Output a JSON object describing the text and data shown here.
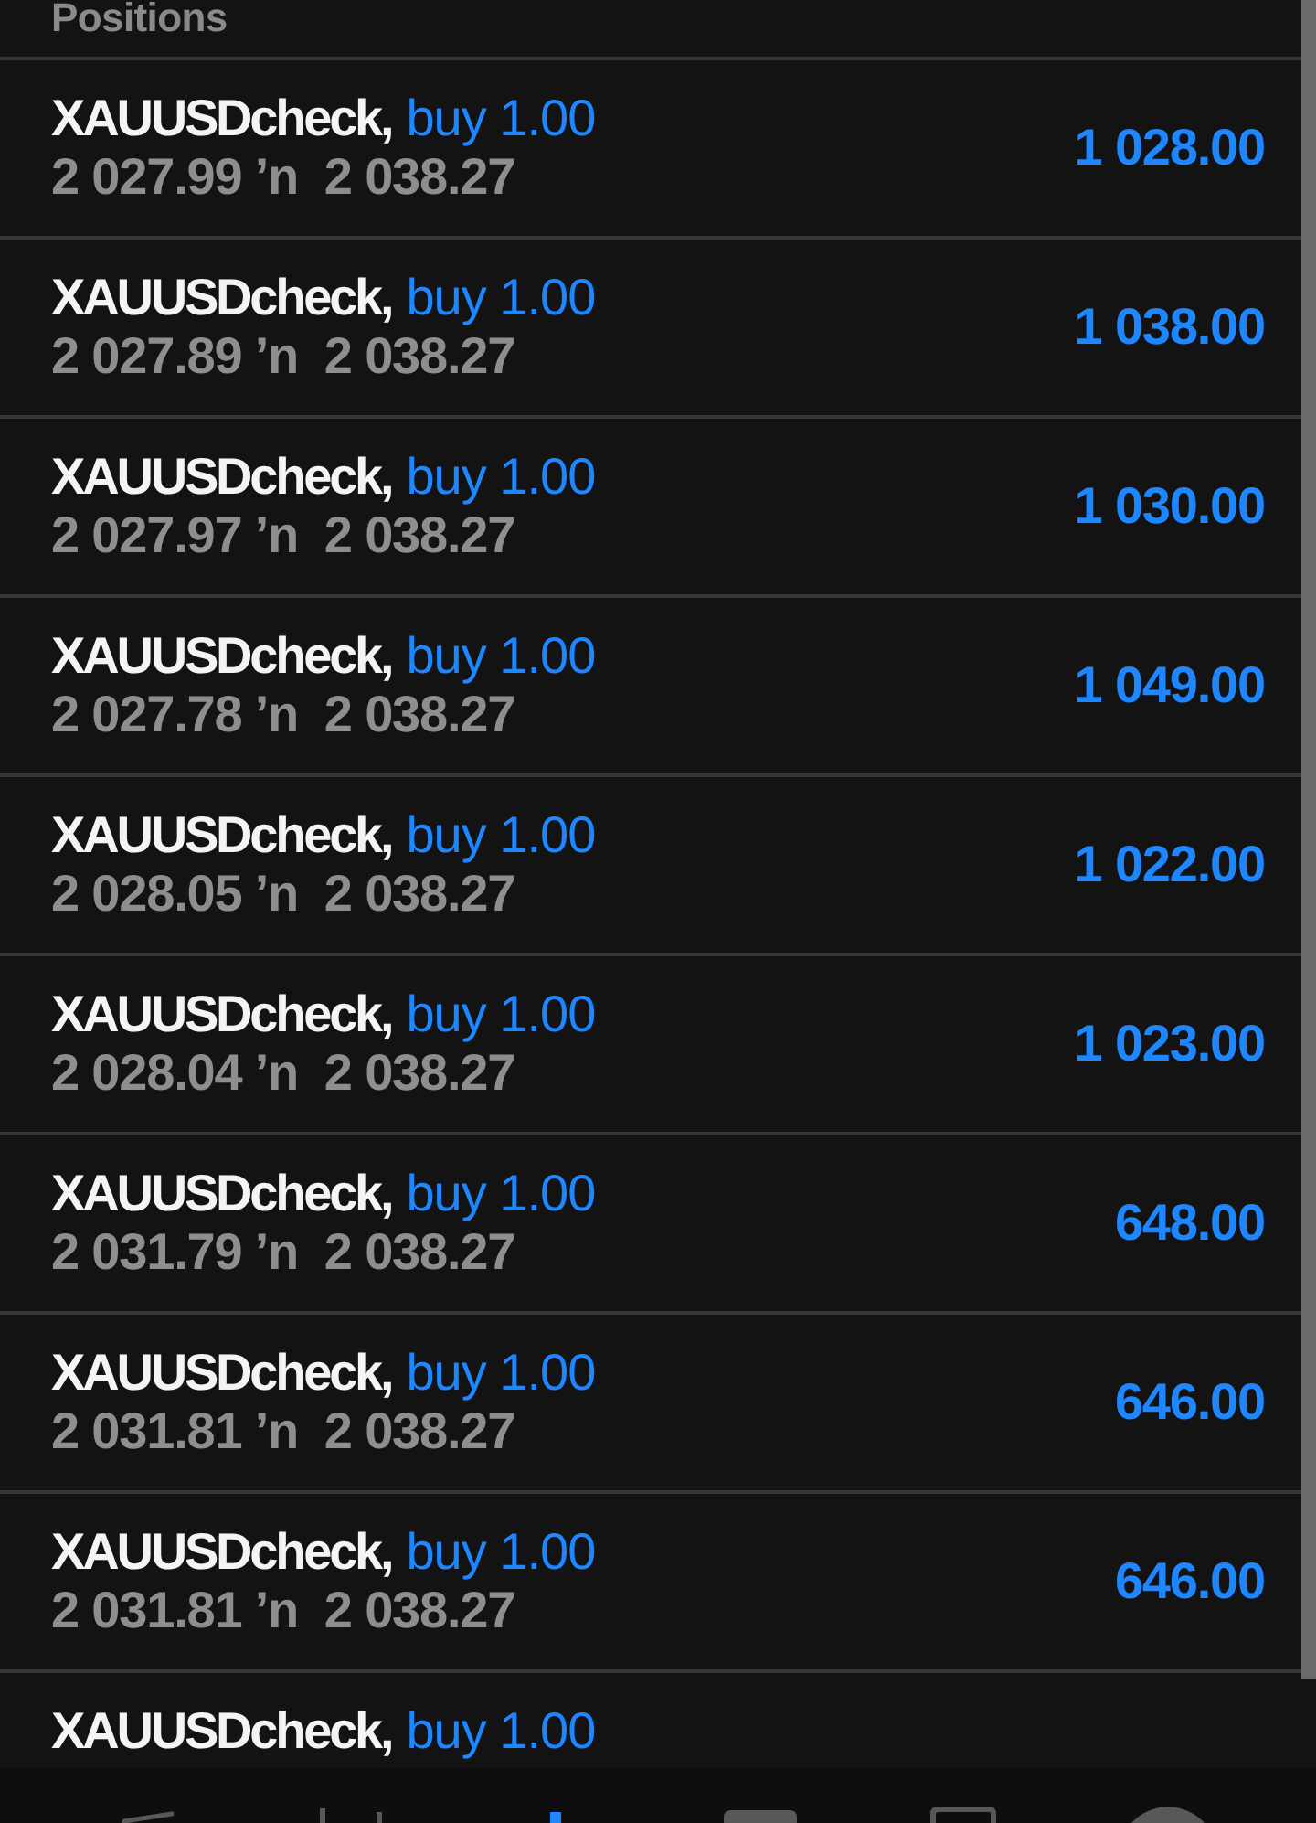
{
  "header": {
    "title": "Positions"
  },
  "positions": [
    {
      "symbol": "XAUUSDcheck,",
      "order": "buy 1.00",
      "prices": "2 027.99 ’n  2 038.27",
      "profit": "1 028.00"
    },
    {
      "symbol": "XAUUSDcheck,",
      "order": "buy 1.00",
      "prices": "2 027.89 ’n  2 038.27",
      "profit": "1 038.00"
    },
    {
      "symbol": "XAUUSDcheck,",
      "order": "buy 1.00",
      "prices": "2 027.97 ’n  2 038.27",
      "profit": "1 030.00"
    },
    {
      "symbol": "XAUUSDcheck,",
      "order": "buy 1.00",
      "prices": "2 027.78 ’n  2 038.27",
      "profit": "1 049.00"
    },
    {
      "symbol": "XAUUSDcheck,",
      "order": "buy 1.00",
      "prices": "2 028.05 ’n  2 038.27",
      "profit": "1 022.00"
    },
    {
      "symbol": "XAUUSDcheck,",
      "order": "buy 1.00",
      "prices": "2 028.04 ’n  2 038.27",
      "profit": "1 023.00"
    },
    {
      "symbol": "XAUUSDcheck,",
      "order": "buy 1.00",
      "prices": "2 031.79 ’n  2 038.27",
      "profit": "648.00"
    },
    {
      "symbol": "XAUUSDcheck,",
      "order": "buy 1.00",
      "prices": "2 031.81 ’n  2 038.27",
      "profit": "646.00"
    },
    {
      "symbol": "XAUUSDcheck,",
      "order": "buy 1.00",
      "prices": "2 031.81 ’n  2 038.27",
      "profit": "646.00"
    },
    {
      "symbol": "XAUUSDcheck,",
      "order": "buy 1.00"
    }
  ],
  "bottom_nav": {
    "items": [
      {
        "selected": false
      },
      {
        "selected": false
      },
      {
        "selected": true
      },
      {
        "selected": false
      },
      {
        "selected": false
      },
      {
        "selected": false
      }
    ]
  }
}
